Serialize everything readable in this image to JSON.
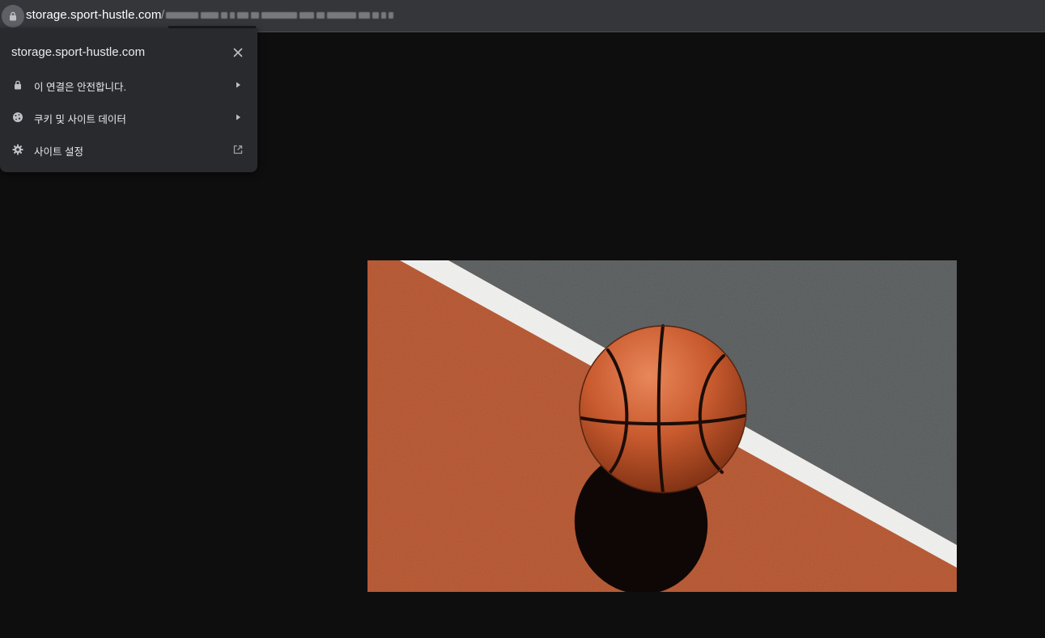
{
  "browser": {
    "url_host": "storage.sport-hustle.com",
    "url_path_prefix": "/",
    "lock_icon": "lock-icon"
  },
  "site_info_popup": {
    "title": "storage.sport-hustle.com",
    "close_icon": "close-icon",
    "items": [
      {
        "icon": "lock-icon",
        "label": "이 연결은 안전합니다.",
        "trailing": "chevron-right-icon"
      },
      {
        "icon": "cookie-icon",
        "label": "쿠키 및 사이트 데이터",
        "trailing": "chevron-right-icon"
      },
      {
        "icon": "gear-icon",
        "label": "사이트 설정",
        "trailing": "external-link-icon"
      }
    ]
  },
  "colors": {
    "page_background": "#0e0e0f",
    "toolbar": "#35363a",
    "popup": "#292a2d",
    "court_orange": "#b8532a",
    "court_gray": "#55595a",
    "court_line": "#f2f2f0"
  }
}
